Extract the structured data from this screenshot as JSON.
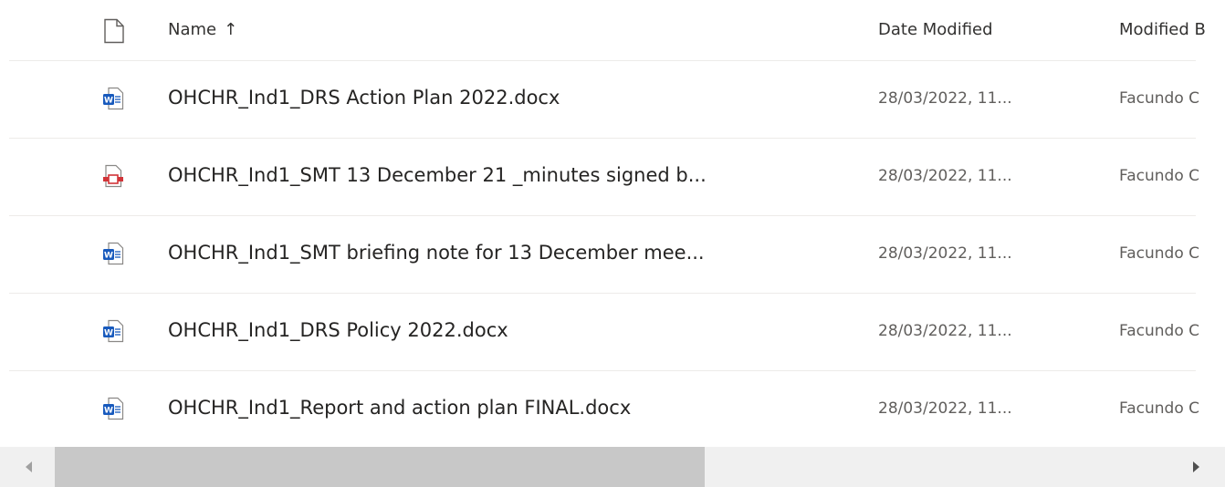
{
  "header": {
    "file_type_icon": "file-icon",
    "name": "Name",
    "sort_indicator": "↑",
    "date_modified": "Date Modified",
    "modified_by": "Modified B"
  },
  "rows": [
    {
      "icon": "word-icon",
      "name": "OHCHR_Ind1_DRS Action Plan 2022.docx",
      "date": "28/03/2022, 11...",
      "modified_by": "Facundo C"
    },
    {
      "icon": "pdf-icon",
      "name": "OHCHR_Ind1_SMT 13 December 21 _minutes signed b...",
      "date": "28/03/2022, 11...",
      "modified_by": "Facundo C"
    },
    {
      "icon": "word-icon",
      "name": "OHCHR_Ind1_SMT briefing note for 13 December mee...",
      "date": "28/03/2022, 11...",
      "modified_by": "Facundo C"
    },
    {
      "icon": "word-icon",
      "name": "OHCHR_Ind1_DRS Policy 2022.docx",
      "date": "28/03/2022, 11...",
      "modified_by": "Facundo C"
    },
    {
      "icon": "word-icon",
      "name": "OHCHR_Ind1_Report and action plan FINAL.docx",
      "date": "28/03/2022, 11...",
      "modified_by": "Facundo C"
    }
  ],
  "colors": {
    "word_blue": "#185abd",
    "pdf_red": "#d13438",
    "divider": "#edebe9",
    "scroll_track": "#f0f0f0",
    "scroll_thumb": "#c8c8c8"
  }
}
